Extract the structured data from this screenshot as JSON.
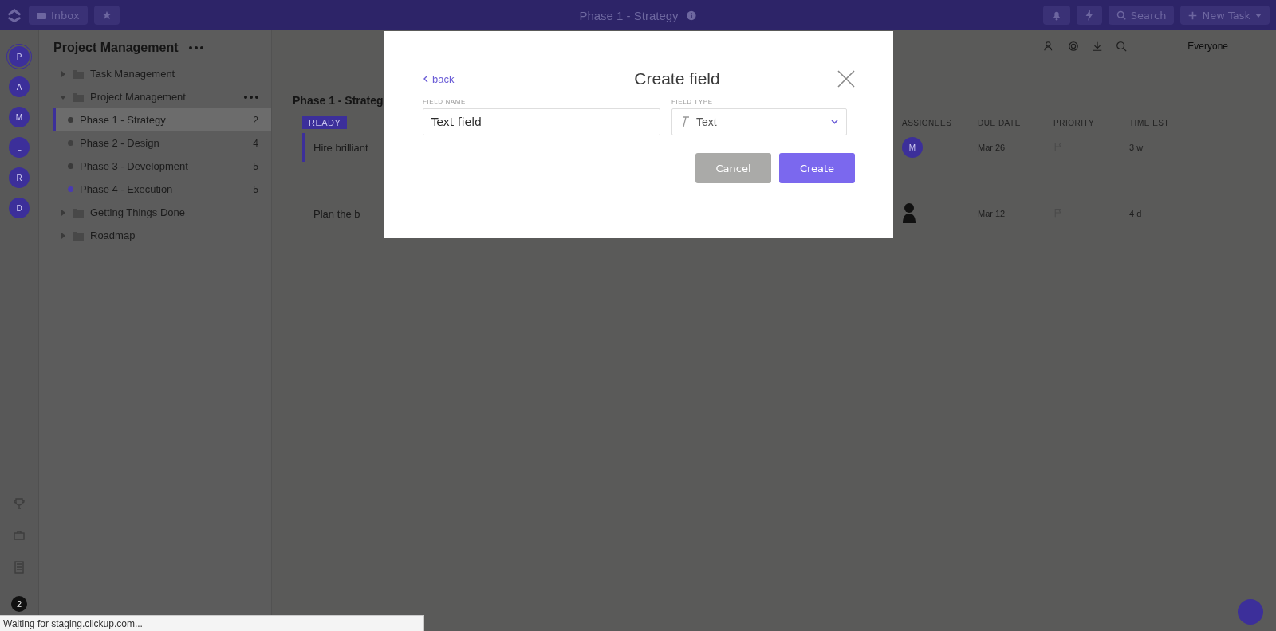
{
  "top_bar": {
    "inbox": "Inbox",
    "title": "Phase 1 - Strategy",
    "search": "Search",
    "new_task": "New Task"
  },
  "workspaces": [
    {
      "letter": "P",
      "selected": true
    },
    {
      "letter": "A",
      "selected": false
    },
    {
      "letter": "M",
      "selected": false
    },
    {
      "letter": "L",
      "selected": false
    },
    {
      "letter": "R",
      "selected": false
    },
    {
      "letter": "D",
      "selected": false
    }
  ],
  "user_badge": "2",
  "sidebar": {
    "title": "Project Management",
    "items": [
      {
        "label": "Task Management",
        "expanded": false
      },
      {
        "label": "Project Management",
        "expanded": true,
        "children": [
          {
            "label": "Phase 1 - Strategy",
            "count": "2",
            "color": "#3a3a3a",
            "selected": true
          },
          {
            "label": "Phase 2 - Design",
            "count": "4",
            "color": "#404040",
            "selected": false
          },
          {
            "label": "Phase 3 - Development",
            "count": "5",
            "color": "#3a3a3a",
            "selected": false
          },
          {
            "label": "Phase 4 - Execution",
            "count": "5",
            "color": "#4a3bb0",
            "selected": false
          }
        ]
      },
      {
        "label": "Getting Things Done",
        "expanded": false
      },
      {
        "label": "Roadmap",
        "expanded": false
      }
    ]
  },
  "toolbar": {
    "everyone": "Everyone"
  },
  "list": {
    "group_title": "Phase 1 - Strateg",
    "status": "READY",
    "columns": [
      "ASSIGNEES",
      "DUE DATE",
      "PRIORITY",
      "TIME EST"
    ],
    "tasks": [
      {
        "name": "Hire brilliant",
        "assignee": "M",
        "due": "Mar 26",
        "time_est": "3 w"
      },
      {
        "name": "Plan the b",
        "due": "Mar 12",
        "time_est": "4 d"
      }
    ]
  },
  "modal": {
    "back": "back",
    "title": "Create field",
    "field_name_label": "FIELD NAME",
    "field_name": "Text field",
    "field_type_label": "FIELD TYPE",
    "field_type": "Text",
    "cancel": "Cancel",
    "create": "Create"
  },
  "status_bar": "Waiting for staging.clickup.com..."
}
